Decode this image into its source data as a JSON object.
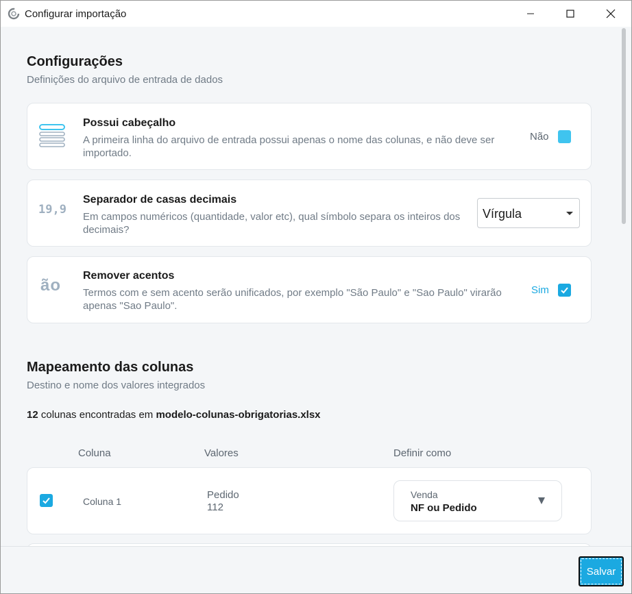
{
  "window": {
    "title": "Configurar importação"
  },
  "config": {
    "title": "Configurações",
    "subtitle": "Definições do arquivo de entrada de dados",
    "header_card": {
      "title": "Possui cabeçalho",
      "desc": "A primeira linha do arquivo de entrada possui apenas o nome das colunas, e não deve ser importado.",
      "toggle_label": "Não",
      "checked": false
    },
    "decimal_card": {
      "icon_text": "19,9",
      "title": "Separador de casas decimais",
      "desc": "Em campos numéricos (quantidade, valor etc), qual símbolo separa os inteiros dos decimais?",
      "selected": "Vírgula"
    },
    "accent_card": {
      "icon_text": "ão",
      "title": "Remover acentos",
      "desc": "Termos com e sem acento serão unificados, por exemplo \"São Paulo\" e \"Sao Paulo\" virarão apenas \"Sao Paulo\".",
      "toggle_label": "Sim",
      "checked": true
    }
  },
  "mapping": {
    "title": "Mapeamento das colunas",
    "subtitle": "Destino e nome dos valores integrados",
    "count": "12",
    "count_text": " colunas encontradas em ",
    "filename": "modelo-colunas-obrigatorias.xlsx",
    "headers": {
      "column": "Coluna",
      "values": "Valores",
      "define": "Definir como"
    },
    "rows": [
      {
        "column": "Coluna 1",
        "values": [
          "Pedido",
          "112"
        ],
        "map_label": "Venda",
        "map_value": "NF ou Pedido",
        "checked": true
      }
    ]
  },
  "footer": {
    "save_label": "Salvar"
  },
  "colors": {
    "accent": "#1ba9e1",
    "muted": "#707b86",
    "background": "#f4f6f8"
  }
}
